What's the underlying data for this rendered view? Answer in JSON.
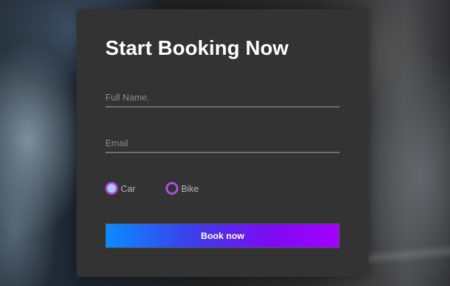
{
  "form": {
    "title": "Start Booking Now",
    "name_placeholder": "Full Name.",
    "name_value": "",
    "email_placeholder": "Email",
    "email_value": "",
    "vehicle_options": [
      {
        "label": "Car",
        "selected": true
      },
      {
        "label": "Bike",
        "selected": false
      }
    ],
    "submit_label": "Book now"
  },
  "colors": {
    "card_background": "#333333",
    "radio_accent": "#b14ee6",
    "radio_checked_fill": "#a9cdf0",
    "button_gradient_start": "#0a8cff",
    "button_gradient_end": "#a400ff"
  }
}
